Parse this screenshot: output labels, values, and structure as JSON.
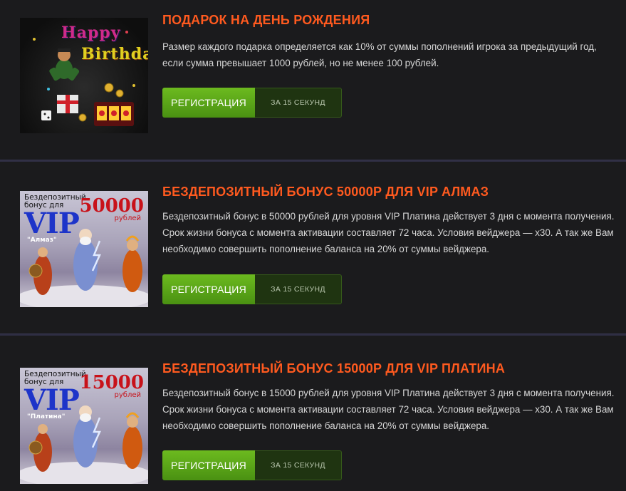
{
  "colors": {
    "background": "#1b1b1d",
    "title": "#ff5a1f",
    "register_button": "#5ea51b",
    "timer_button": "#1f3411",
    "divider": "#2e2d42"
  },
  "bonuses": [
    {
      "title": "ПОДАРОК НА ДЕНЬ РОЖДЕНИЯ",
      "description": "Размер каждого подарка определяется как 10% от суммы пополнений игрока за предыдущий год, если сумма превышает 1000 рублей, но не менее 100 рублей.",
      "register_label": "РЕГИСТРАЦИЯ",
      "timer_label": "ЗА 15 СЕКУНД",
      "image": {
        "line1": "Happy",
        "line2": "Birthday"
      }
    },
    {
      "title": "БЕЗДЕПОЗИТНЫЙ БОНУС 50000Р ДЛЯ VIP АЛМАЗ",
      "description": "Бездепозитный бонус в 50000 рублей для уровня VIP Платина действует 3 дня с момента получения. Срок жизни бонуса с момента активации составляет 72 часа. Условия вейджера — х30. А так же Вам необходимо совершить пополнение баланса на 20% от суммы вейджера.",
      "register_label": "РЕГИСТРАЦИЯ",
      "timer_label": "ЗА 15 СЕКУНД",
      "image": {
        "caption": "Бездепозитный бонус для",
        "vip": "VIP",
        "tier": "\"Алмаз\"",
        "amount": "50000",
        "currency": "рублей"
      }
    },
    {
      "title": "БЕЗДЕПОЗИТНЫЙ БОНУС 15000Р ДЛЯ VIP ПЛАТИНА",
      "description": "Бездепозитный бонус в 15000 рублей для уровня VIP Платина действует 3 дня с момента получения. Срок жизни бонуса с момента активации составляет 72 часа. Условия вейджера — х30. А так же Вам необходимо совершить пополнение баланса на 20% от суммы вейджера.",
      "register_label": "РЕГИСТРАЦИЯ",
      "timer_label": "ЗА 15 СЕКУНД",
      "image": {
        "caption": "Бездепозитный бонус для",
        "vip": "VIP",
        "tier": "\"Платина\"",
        "amount": "15000",
        "currency": "рублей"
      }
    }
  ]
}
